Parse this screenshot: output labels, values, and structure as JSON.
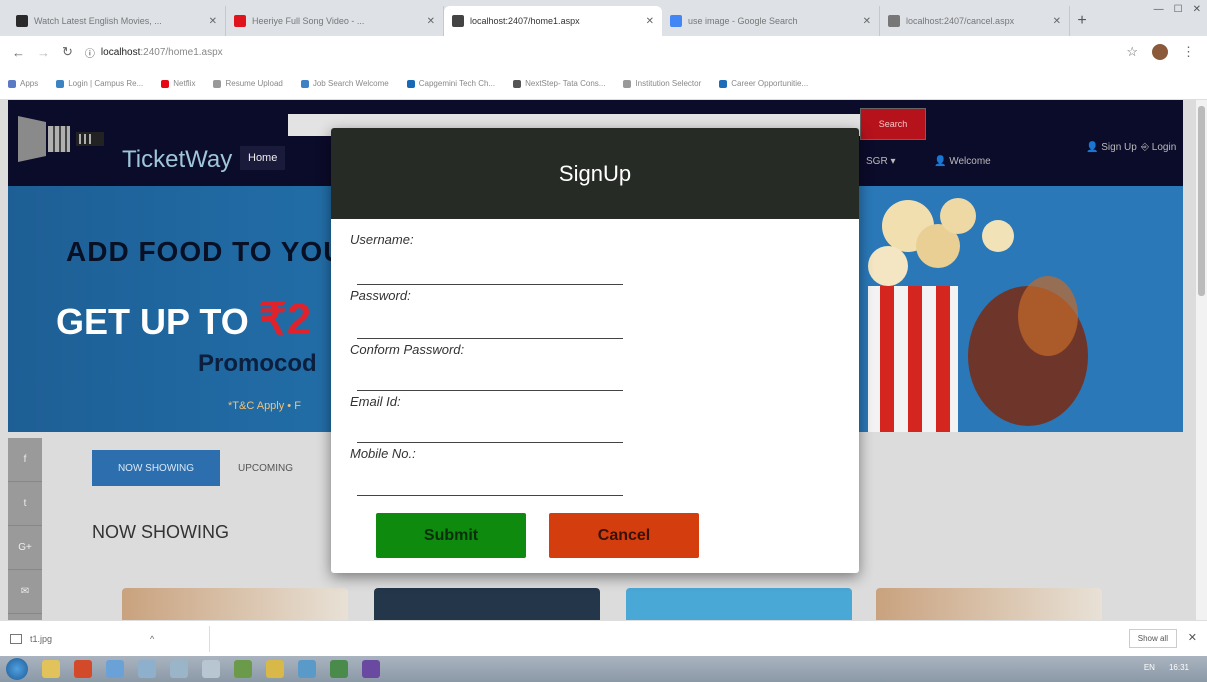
{
  "browser": {
    "tabs": [
      {
        "title": "Watch Latest English Movies, ...",
        "favicon_color": "#2a2a2a"
      },
      {
        "title": "Heeriye Full Song Video - ...",
        "favicon_color": "#e0141c"
      },
      {
        "title": "localhost:2407/home1.aspx",
        "favicon_color": "#444444"
      },
      {
        "title": "use image - Google Search",
        "favicon_color": "#4285f4"
      },
      {
        "title": "localhost:2407/cancel.aspx",
        "favicon_color": "#777777"
      }
    ],
    "url_host": "localhost",
    "url_path": ":2407/home1.aspx",
    "bookmarks": [
      {
        "label": "Apps",
        "color": "#5a7bc4"
      },
      {
        "label": "Login | Campus Re...",
        "color": "#3b83c2"
      },
      {
        "label": "Netflix",
        "color": "#e50914"
      },
      {
        "label": "Resume Upload",
        "color": "#999999"
      },
      {
        "label": "Job Search Welcome",
        "color": "#3e82c5"
      },
      {
        "label": "Capgemini Tech Ch...",
        "color": "#1769b7"
      },
      {
        "label": "NextStep- Tata Cons...",
        "color": "#555555"
      },
      {
        "label": "Institution Selector",
        "color": "#999999"
      },
      {
        "label": "Career Opportunitie...",
        "color": "#1e6bb8"
      }
    ]
  },
  "site": {
    "brand": "TicketWay",
    "nav_home": "Home",
    "search_button": "Search",
    "signup_link": "Sign Up",
    "login_link": "Login",
    "city": "SGR",
    "welcome": "Welcome"
  },
  "banner": {
    "line1": "ADD FOOD TO YOUR M",
    "line2_prefix": "GET UP TO ",
    "line2_amount": "₹2",
    "line3": "Promocod",
    "line4": "*T&C Apply • F"
  },
  "content": {
    "tab_now": "NOW SHOWING",
    "tab_upcoming": "UPCOMING",
    "section_title": "NOW SHOWING",
    "social": [
      "f",
      "t",
      "G+",
      "✉"
    ]
  },
  "modal": {
    "title": "SignUp",
    "fields": [
      {
        "label": "Username:"
      },
      {
        "label": "Password:"
      },
      {
        "label": "Conform Password:"
      },
      {
        "label": "Email Id:"
      },
      {
        "label": "Mobile No.:"
      }
    ],
    "submit": "Submit",
    "cancel": "Cancel"
  },
  "downloads": {
    "file": "t1.jpg",
    "show_all": "Show all"
  },
  "taskbar": {
    "time": "16:31",
    "locale": "EN"
  }
}
